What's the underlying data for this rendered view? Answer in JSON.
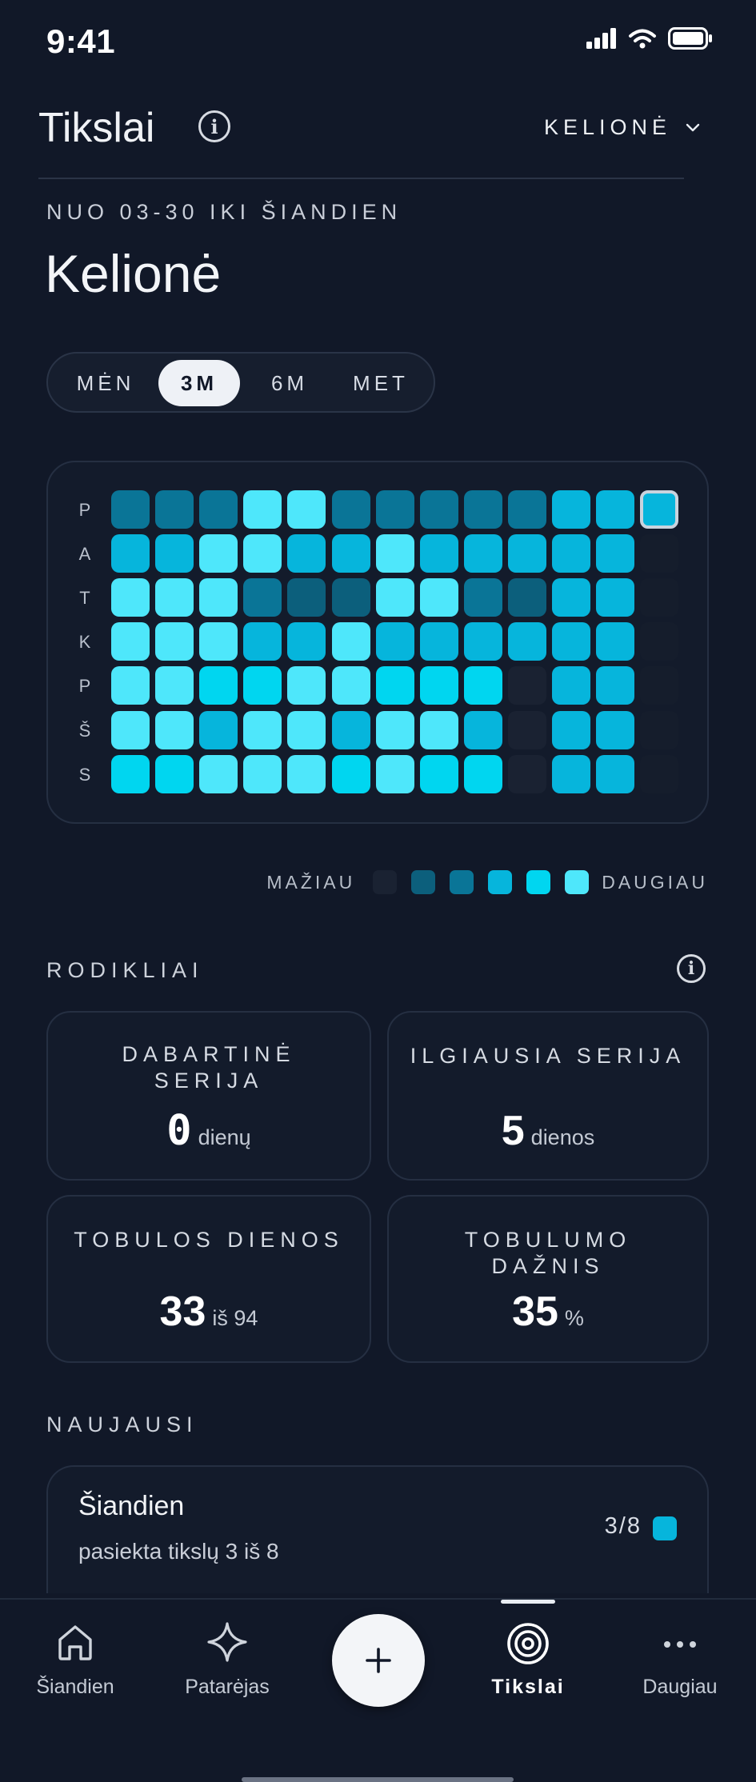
{
  "status": {
    "time": "9:41"
  },
  "header": {
    "title": "Tikslai",
    "goal_select": "KELIONĖ"
  },
  "range_label": "NUO 03-30 IKI ŠIANDIEN",
  "goal_title": "Kelionė",
  "periods": [
    {
      "label": "MĖN",
      "active": false
    },
    {
      "label": "3M",
      "active": true
    },
    {
      "label": "6M",
      "active": false
    },
    {
      "label": "MET",
      "active": false
    }
  ],
  "heatmap": {
    "day_labels": [
      "P",
      "A",
      "T",
      "K",
      "P",
      "Š",
      "S"
    ],
    "palette": [
      "#1a2232",
      "#0c5f7c",
      "#0a7597",
      "#06b5dc",
      "#00d6f0",
      "#4ee7fb"
    ],
    "columns": [
      [
        2,
        3,
        5,
        5,
        5,
        5,
        4
      ],
      [
        2,
        3,
        5,
        5,
        5,
        5,
        4
      ],
      [
        2,
        5,
        5,
        5,
        4,
        3,
        5
      ],
      [
        5,
        5,
        2,
        3,
        4,
        5,
        5
      ],
      [
        5,
        3,
        1,
        3,
        5,
        5,
        5
      ],
      [
        2,
        3,
        1,
        5,
        5,
        3,
        4
      ],
      [
        2,
        5,
        5,
        3,
        4,
        5,
        5
      ],
      [
        2,
        3,
        5,
        3,
        4,
        5,
        4
      ],
      [
        2,
        3,
        2,
        3,
        4,
        3,
        4
      ],
      [
        2,
        3,
        1,
        3,
        0,
        0,
        0
      ],
      [
        3,
        3,
        3,
        3,
        3,
        3,
        3
      ],
      [
        3,
        3,
        3,
        3,
        3,
        3,
        3
      ],
      [
        3,
        0,
        0,
        0,
        0,
        0,
        0
      ]
    ],
    "today": {
      "col": 12,
      "row": 0
    }
  },
  "legend": {
    "less": "MAŽIAU",
    "more": "DAUGIAU"
  },
  "metrics": {
    "title": "RODIKLIAI",
    "current_streak": {
      "label": "DABARTINĖ SERIJA",
      "value": "0",
      "unit": "dienų"
    },
    "longest_streak": {
      "label": "ILGIAUSIA SERIJA",
      "value": "5",
      "unit": "dienos"
    },
    "perfect_days": {
      "label": "TOBULOS DIENOS",
      "value": "33",
      "unit": "iš 94"
    },
    "perfect_rate": {
      "label": "TOBULUMO DAŽNIS",
      "value": "35",
      "unit": "%"
    }
  },
  "recent": {
    "title": "NAUJAUSI",
    "items": [
      {
        "day": "Šiandien",
        "subtitle": "pasiekta tikslų 3 iš 8",
        "count": "3/8",
        "color": "#06b5dc"
      }
    ]
  },
  "tabs": [
    {
      "label": "Šiandien",
      "icon": "home-icon"
    },
    {
      "label": "Patarėjas",
      "icon": "sparkle-icon"
    },
    {
      "label": "Tikslai",
      "icon": "target-icon",
      "active": true
    },
    {
      "label": "Daugiau",
      "icon": "more-icon"
    }
  ]
}
